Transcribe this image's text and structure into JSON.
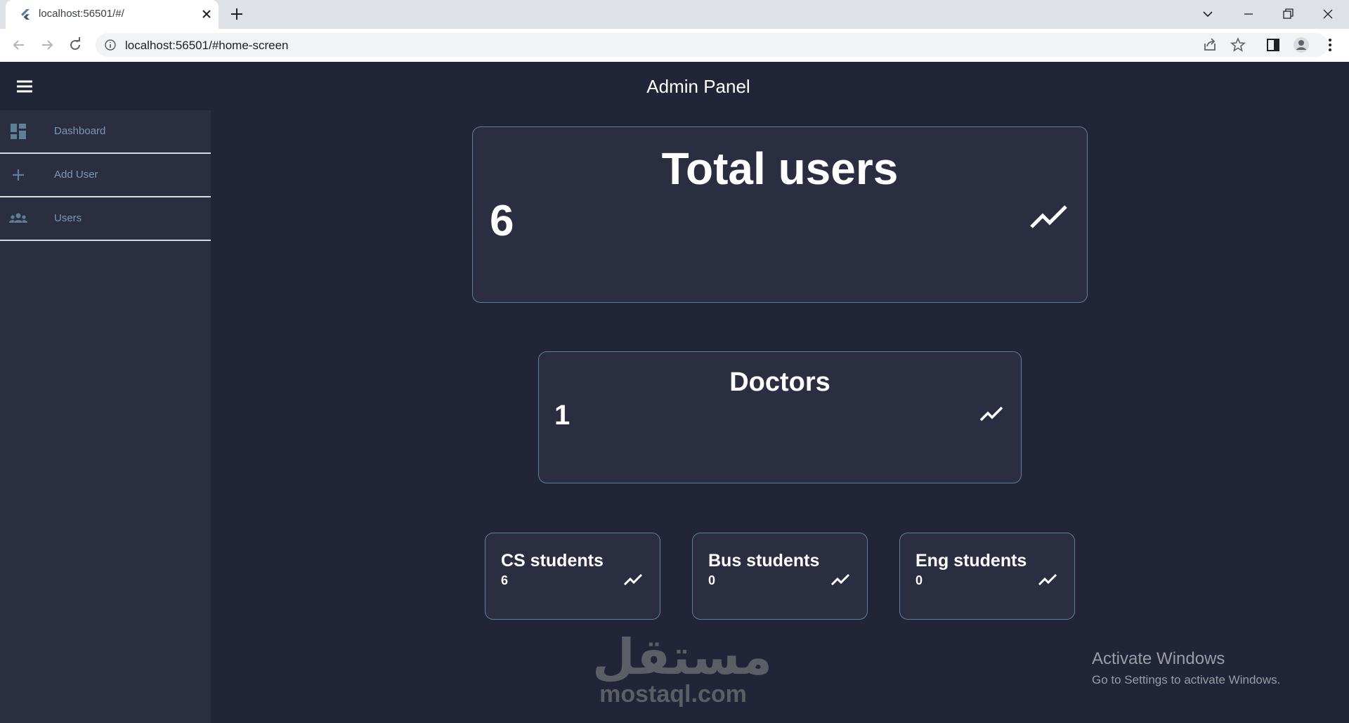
{
  "browser": {
    "tab_title": "localhost:56501/#/",
    "url": "localhost:56501/#home-screen"
  },
  "app": {
    "title": "Admin Panel"
  },
  "sidebar": {
    "items": [
      {
        "label": "Dashboard",
        "icon": "dashboard-icon"
      },
      {
        "label": "Add User",
        "icon": "plus-icon"
      },
      {
        "label": "Users",
        "icon": "group-icon"
      }
    ]
  },
  "cards": {
    "total": {
      "title": "Total users",
      "value": "6"
    },
    "doctors": {
      "title": "Doctors",
      "value": "1"
    },
    "cs": {
      "title": "CS students",
      "value": "6"
    },
    "bus": {
      "title": "Bus students",
      "value": "0"
    },
    "eng": {
      "title": "Eng students",
      "value": "0"
    }
  },
  "watermark": {
    "arabic": "مستقل",
    "latin": "mostaql.com"
  },
  "os_overlay": {
    "line1": "Activate Windows",
    "line2": "Go to Settings to activate Windows."
  },
  "colors": {
    "background": "#222437",
    "sidebar": "#2b2d41",
    "card_border": "#5f7f99",
    "nav_text": "#7e98b3"
  }
}
